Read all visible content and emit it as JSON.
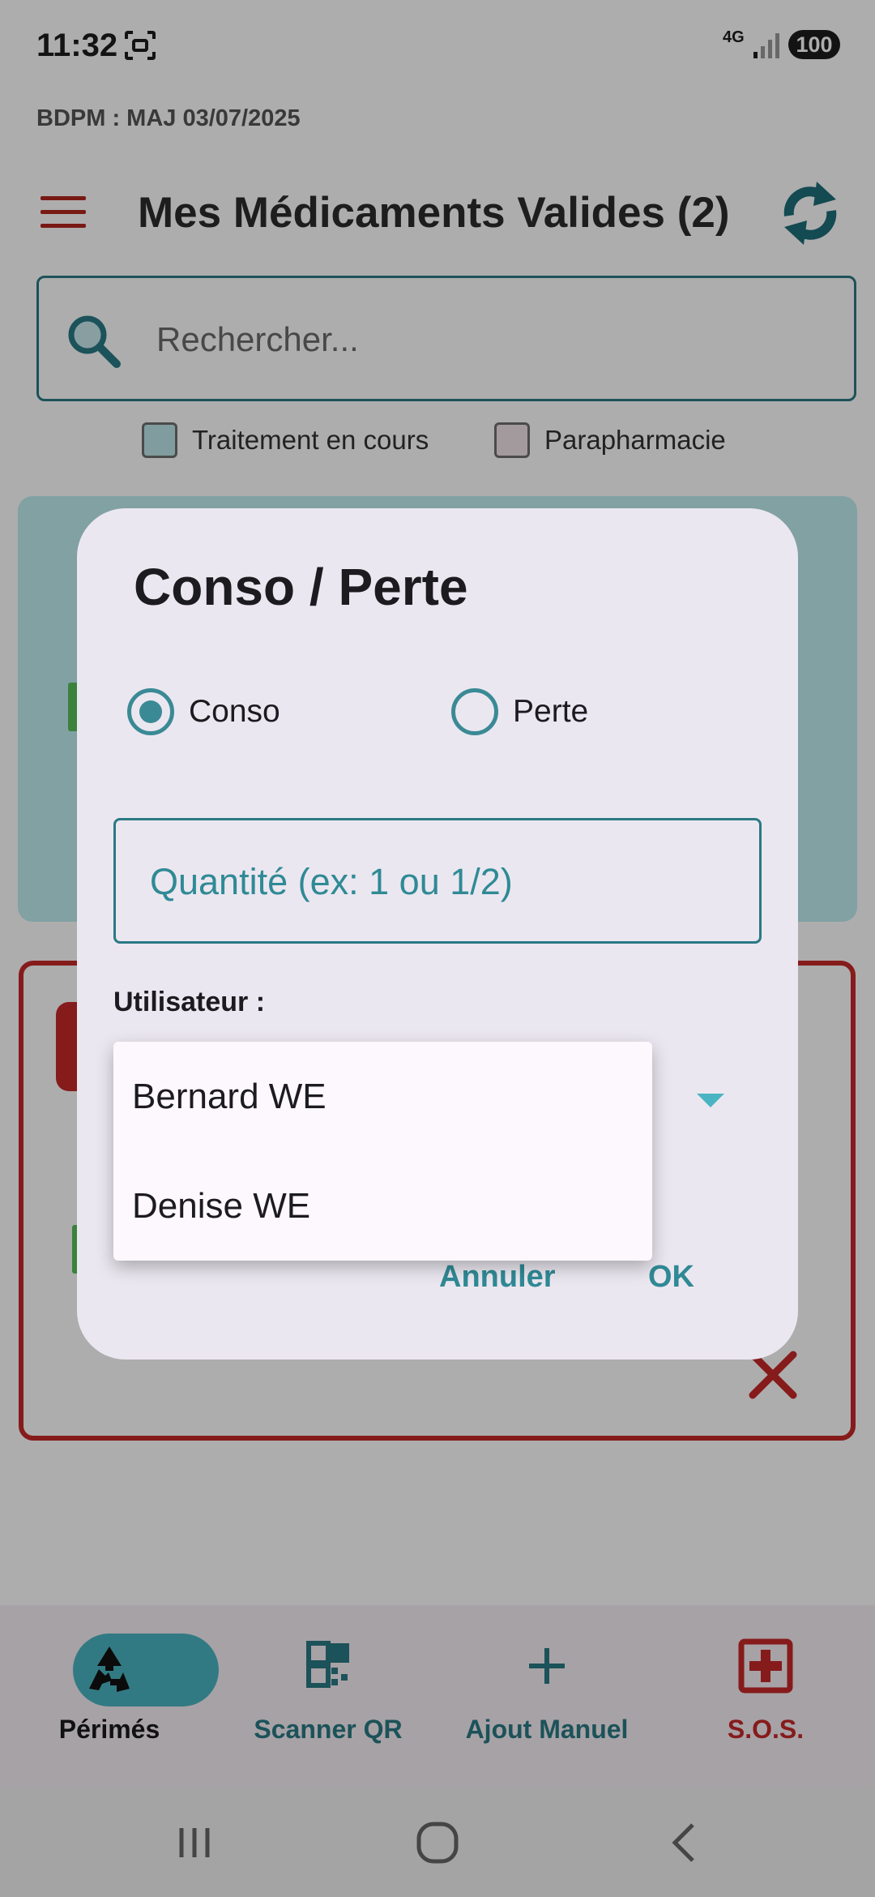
{
  "status_bar": {
    "time": "11:32",
    "network": "4G",
    "battery": "100",
    "icons": [
      "screenshot-icon",
      "signal-icon"
    ]
  },
  "header": {
    "db_version": "BDPM : MAJ 03/07/2025",
    "title": "Mes Médicaments Valides (2)",
    "icons": [
      "menu-icon",
      "sync-icon"
    ]
  },
  "search": {
    "placeholder": "Rechercher..."
  },
  "filters": {
    "treatment_label": "Traitement en cours",
    "parapharmacy_label": "Parapharmacie"
  },
  "bottom_nav": {
    "items": [
      {
        "label": "Périmés",
        "icon": "recycle-icon",
        "active": true
      },
      {
        "label": "Scanner QR",
        "icon": "qr-code-icon"
      },
      {
        "label": "Ajout Manuel",
        "icon": "plus-icon"
      },
      {
        "label": "S.O.S.",
        "icon": "medical-cross-icon"
      }
    ]
  },
  "dialog": {
    "title": "Conso / Perte",
    "options": [
      {
        "label": "Conso",
        "selected": true
      },
      {
        "label": "Perte",
        "selected": false
      }
    ],
    "quantity_placeholder": "Quantité (ex: 1 ou 1/2)",
    "user_label": "Utilisateur :",
    "users": [
      "Bernard WE",
      "Denise WE"
    ],
    "cancel_label": "Annuler",
    "ok_label": "OK"
  },
  "colors": {
    "accent": "#2a7a84",
    "danger": "#c62828",
    "dialog_bg": "#ebe7f0",
    "card_teal": "#bfeef0"
  }
}
